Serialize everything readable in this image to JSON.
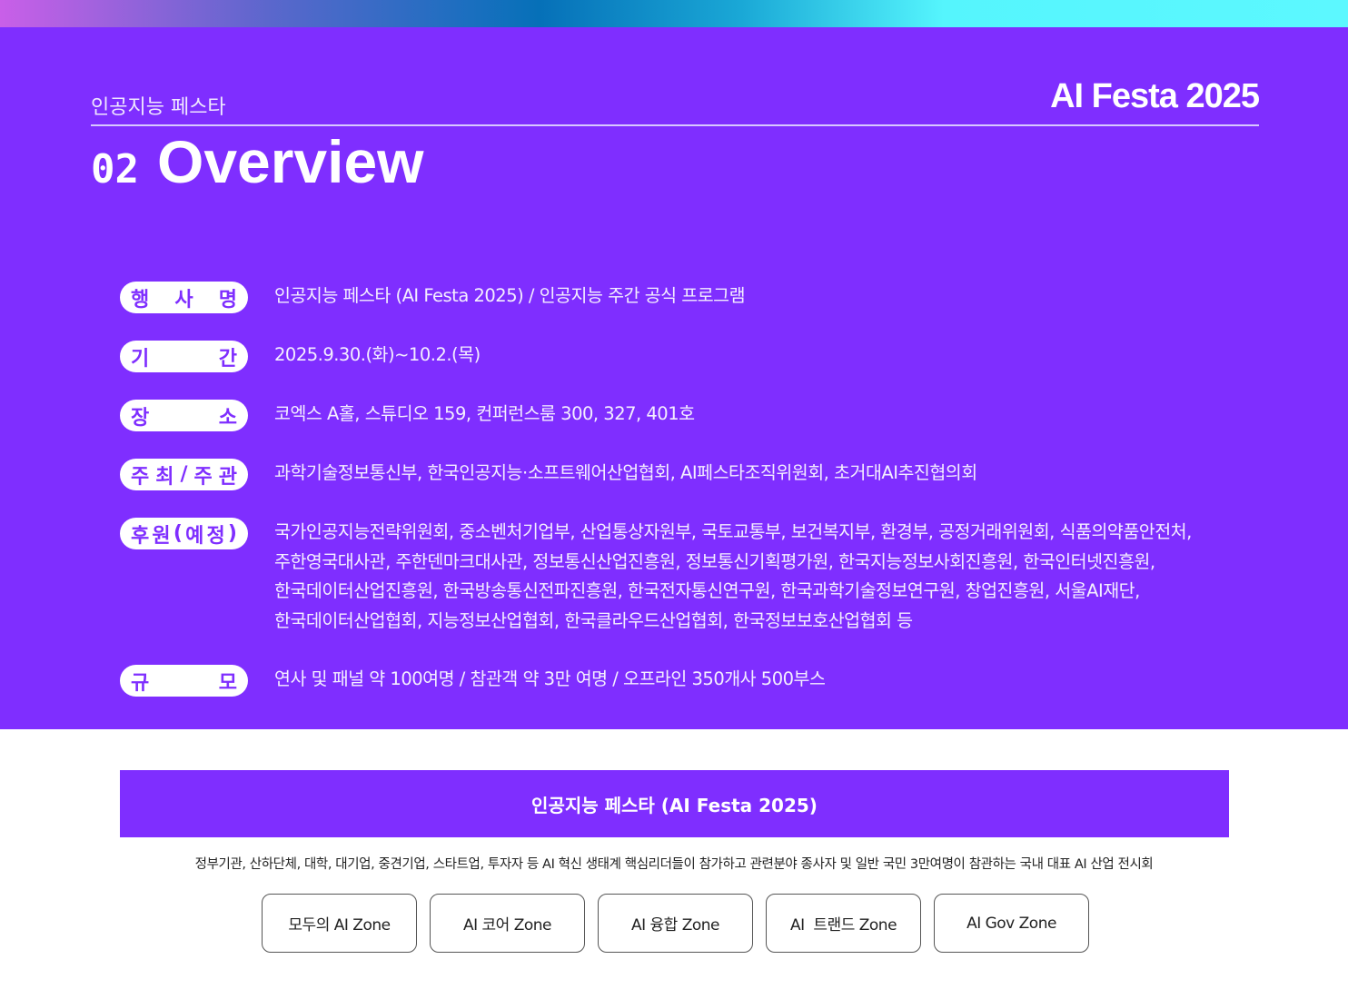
{
  "header": {
    "subtitle": "인공지능 페스타",
    "brand": "AI Festa 2025",
    "section_number": "02",
    "section_title": "Overview"
  },
  "rows": [
    {
      "label": [
        "행",
        "사",
        "명"
      ],
      "lines": [
        "인공지능 페스타 (AI Festa 2025) / 인공지능 주간 공식 프로그램"
      ]
    },
    {
      "label": [
        "기",
        "간"
      ],
      "lines": [
        "2025.9.30.(화)~10.2.(목)"
      ]
    },
    {
      "label": [
        "장",
        "소"
      ],
      "lines": [
        "코엑스 A홀, 스튜디오 159, 컨퍼런스룸 300, 327, 401호"
      ]
    },
    {
      "label": [
        "주",
        "최",
        "/",
        "주",
        "관"
      ],
      "lines": [
        "과학기술정보통신부, 한국인공지능·소프트웨어산업협회, AI페스타조직위원회, 초거대AI추진협의회"
      ]
    },
    {
      "label": [
        "후",
        "원",
        "(",
        "예",
        "정",
        ")"
      ],
      "lines": [
        "국가인공지능전략위원회, 중소벤처기업부, 산업통상자원부, 국토교통부, 보건복지부, 환경부, 공정거래위원회, 식품의약품안전처,",
        "주한영국대사관, 주한덴마크대사관, 정보통신산업진흥원, 정보통신기획평가원, 한국지능정보사회진흥원, 한국인터넷진흥원,",
        "한국데이터산업진흥원, 한국방송통신전파진흥원, 한국전자통신연구원, 한국과학기술정보연구원, 창업진흥원, 서울AI재단,",
        "한국데이터산업협회, 지능정보산업협회, 한국클라우드산업협회, 한국정보보호산업협회 등"
      ]
    },
    {
      "label": [
        "규",
        "모"
      ],
      "lines": [
        "연사 및 패널 약 100여명 / 참관객 약 3만 여명 / 오프라인 350개사 500부스"
      ]
    }
  ],
  "banner": {
    "title": "인공지능 페스타 (AI Festa 2025)",
    "description": "정부기관, 산하단체, 대학, 대기업, 중견기업, 스타트업, 투자자 등 AI 혁신 생태계 핵심리더들이 참가하고 관련분야 종사자 및 일반 국민 3만여명이 참관하는 국내 대표 AI 산업 전시회"
  },
  "zones": [
    "모두의 AI Zone",
    "AI 코어 Zone",
    "AI 융합 Zone",
    "AI  트랜드 Zone",
    "AI Gov Zone"
  ],
  "colors": {
    "primary": "#7f2eff"
  }
}
